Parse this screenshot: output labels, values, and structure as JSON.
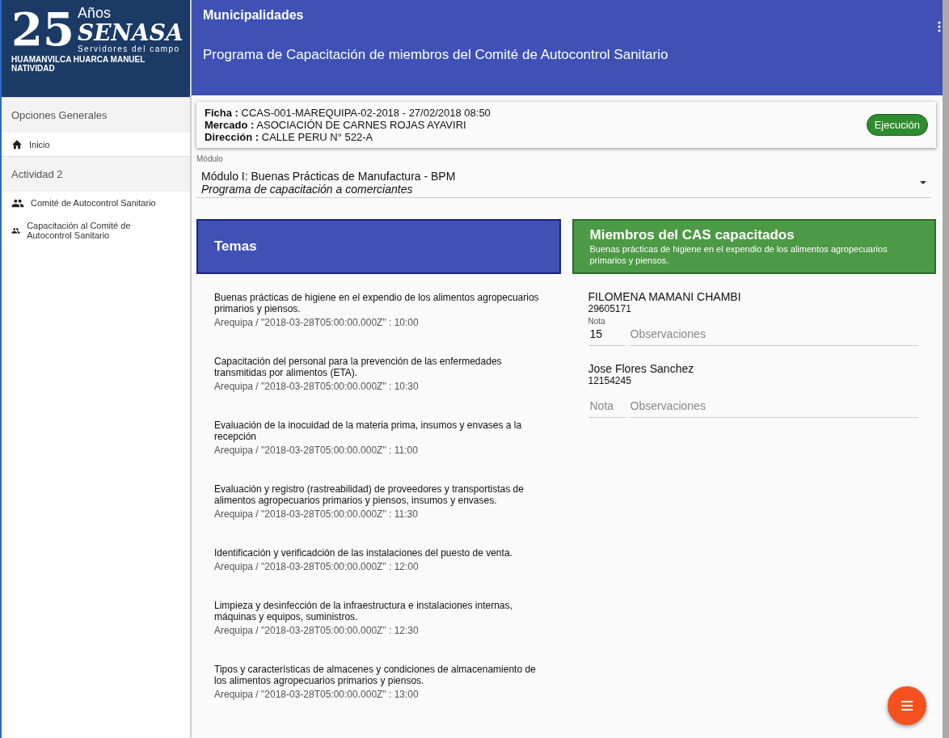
{
  "logo": {
    "number": "25",
    "years": "Años",
    "brand": "SENASA",
    "tagline": "Servidores del campo"
  },
  "user": {
    "name": "HUAMANVILCA HUARCA MANUEL NATIVIDAD"
  },
  "sidebar": {
    "items": [
      {
        "kind": "section",
        "label": "Opciones Generales"
      },
      {
        "kind": "home",
        "label": "Inicio"
      },
      {
        "kind": "section",
        "label": "Actividad 2"
      },
      {
        "kind": "group",
        "label": "Comité de Autocontrol Sanitario"
      },
      {
        "kind": "group",
        "label": "Capacitación al Comité de Autocontrol Sanitario"
      }
    ]
  },
  "header": {
    "section": "Municipalidades",
    "title": "Programa de Capacitación de miembros del Comité de Autocontrol Sanitario"
  },
  "ficha": {
    "lines": [
      {
        "label": "Ficha :",
        "value": "CCAS-001-MAREQUIPA-02-2018 - 27/02/2018 08:50"
      },
      {
        "label": "Mercado :",
        "value": "ASOCIACIÓN DE CARNES ROJAS AYAVIRI"
      },
      {
        "label": "Dirección :",
        "value": "CALLE PERU N° 522-A"
      }
    ],
    "status": "Ejecución"
  },
  "module": {
    "label": "Módulo",
    "value": "Módulo I: Buenas Prácticas de Manufactura - BPM",
    "subtitle": "Programa de capacitación a comerciantes"
  },
  "topics": {
    "title": "Temas",
    "items": [
      {
        "title": "Buenas prácticas de higiene en el expendio de los alimentos agropecuarios primarios y piensos.",
        "meta": "Arequipa / \"2018-03-28T05:00:00.000Z\" : 10:00"
      },
      {
        "title": "Capacitación del personal para la prevención de las enfermedades transmitidas por alimentos (ETA).",
        "meta": "Arequipa / \"2018-03-28T05:00:00.000Z\" : 10:30"
      },
      {
        "title": "Evaluación de la inocuidad de la materia prima, insumos y envases a la recepción",
        "meta": "Arequipa / \"2018-03-28T05:00:00.000Z\" : 11:00"
      },
      {
        "title": "Evaluación y registro (rastreabilidad) de proveedores y transportistas de alimentos agropecuarios primarios y piensos, insumos y envases.",
        "meta": "Arequipa / \"2018-03-28T05:00:00.000Z\" : 11:30"
      },
      {
        "title": "Identificación y verificadción de las instalaciones del puesto de venta.",
        "meta": "Arequipa / \"2018-03-28T05:00:00.000Z\" : 12:00"
      },
      {
        "title": "Limpieza y desinfección de la infraestructura e instalaciones internas, máquinas y equipos, suministros.",
        "meta": "Arequipa / \"2018-03-28T05:00:00.000Z\" : 12:30"
      },
      {
        "title": "Tipos y características de almacenes y condiciones de almacenamiento de los alimentos agropecuarios primarios y piensos.",
        "meta": "Arequipa / \"2018-03-28T05:00:00.000Z\" : 13:00"
      }
    ]
  },
  "members": {
    "title": "Miembros del CAS capacitados",
    "subtitle": "Buenas prácticas de higiene en el expendio de los alimentos agropecuarios primarios y piensos.",
    "items": [
      {
        "name": "FILOMENA MAMANI CHAMBI",
        "id": "29605171",
        "nota": {
          "label": "Nota",
          "value": "15"
        },
        "observaciones": {
          "placeholder": "Observaciones"
        }
      },
      {
        "name": "Jose Flores Sanchez",
        "id": "12154245",
        "nota": {
          "placeholder": "Nota"
        },
        "observaciones": {
          "placeholder": "Observaciones"
        }
      }
    ]
  }
}
